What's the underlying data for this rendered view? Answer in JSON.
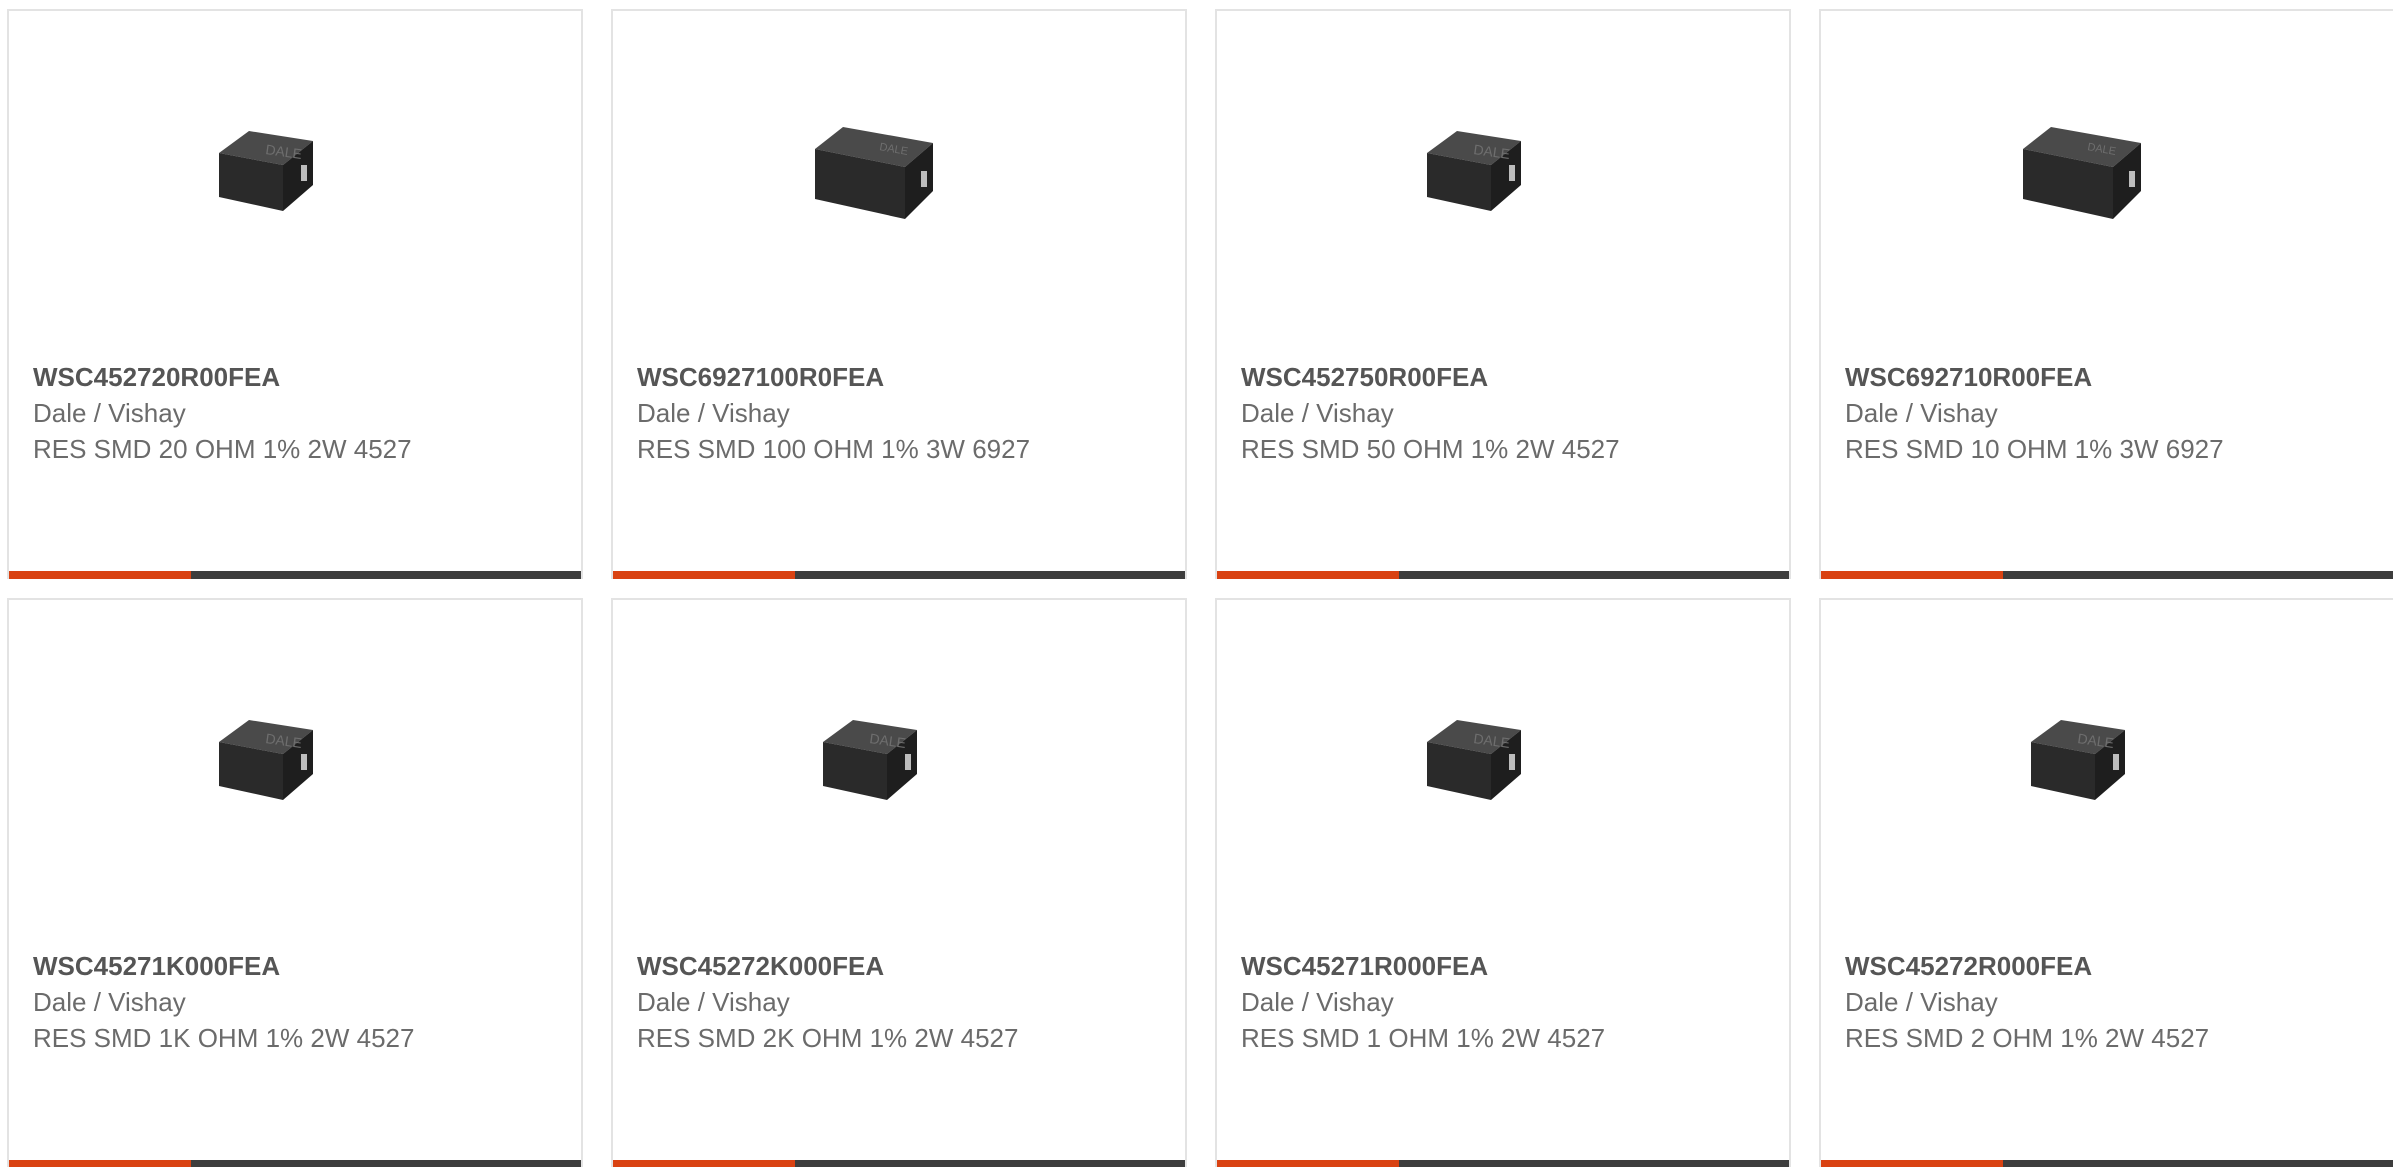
{
  "colors": {
    "accent": "#d94212",
    "bar": "#3d3d3d",
    "border": "#e3e3e3",
    "part_text": "#555555",
    "body_text": "#6b6b6b"
  },
  "products": [
    {
      "part": "WSC452720R00FEA",
      "manufacturer": "Dale / Vishay",
      "description": "RES SMD 20 OHM 1% 2W 4527",
      "image_icon": "resistor-4527-icon",
      "label": "DALE"
    },
    {
      "part": "WSC6927100R0FEA",
      "manufacturer": "Dale / Vishay",
      "description": "RES SMD 100 OHM 1% 3W 6927",
      "image_icon": "resistor-6927-icon",
      "label": "DALE"
    },
    {
      "part": "WSC452750R00FEA",
      "manufacturer": "Dale / Vishay",
      "description": "RES SMD 50 OHM 1% 2W 4527",
      "image_icon": "resistor-4527-icon",
      "label": "DALE"
    },
    {
      "part": "WSC692710R00FEA",
      "manufacturer": "Dale / Vishay",
      "description": "RES SMD 10 OHM 1% 3W 6927",
      "image_icon": "resistor-6927-icon",
      "label": "DALE"
    },
    {
      "part": "WSC45271K000FEA",
      "manufacturer": "Dale / Vishay",
      "description": "RES SMD 1K OHM 1% 2W 4527",
      "image_icon": "resistor-4527-icon",
      "label": "DALE"
    },
    {
      "part": "WSC45272K000FEA",
      "manufacturer": "Dale / Vishay",
      "description": "RES SMD 2K OHM 1% 2W 4527",
      "image_icon": "resistor-4527-icon",
      "label": "DALE"
    },
    {
      "part": "WSC45271R000FEA",
      "manufacturer": "Dale / Vishay",
      "description": "RES SMD 1 OHM 1% 2W 4527",
      "image_icon": "resistor-4527-icon",
      "label": "DALE"
    },
    {
      "part": "WSC45272R000FEA",
      "manufacturer": "Dale / Vishay",
      "description": "RES SMD 2 OHM 1% 2W 4527",
      "image_icon": "resistor-4527-icon",
      "label": "DALE"
    }
  ]
}
